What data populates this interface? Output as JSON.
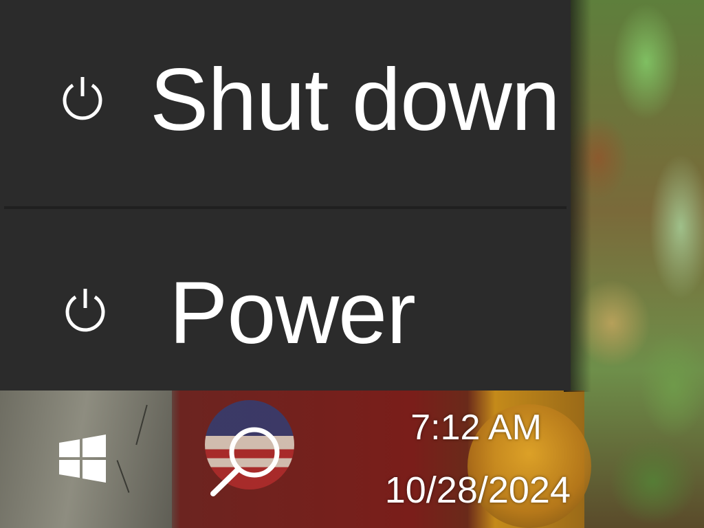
{
  "power_menu": {
    "items": [
      {
        "label": "Shut down",
        "icon": "power-icon"
      },
      {
        "label": "Power",
        "icon": "power-icon"
      }
    ]
  },
  "taskbar": {
    "start_icon": "windows-logo-icon",
    "search_icon": "search-icon",
    "clock": {
      "time": "7:12 AM",
      "date": "10/28/2024"
    }
  },
  "colors": {
    "menu_background": "#2b2b2b",
    "menu_divider": "#1f1f1f",
    "text": "#ffffff"
  }
}
